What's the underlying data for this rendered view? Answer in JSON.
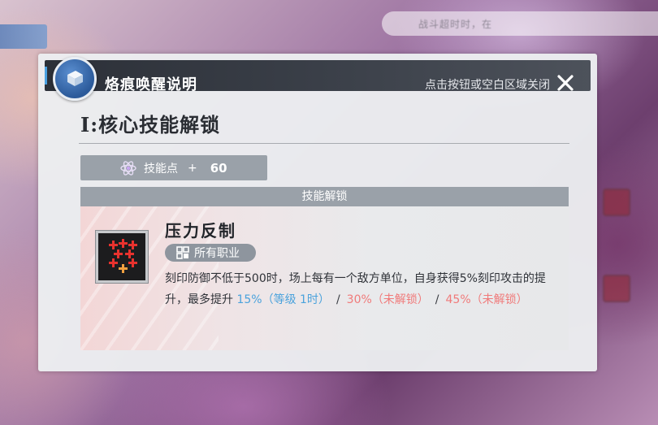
{
  "background": {
    "hint_text": "战斗超时时，在"
  },
  "dialog": {
    "title": "烙痕唤醒说明",
    "close_hint": "点击按钮或空白区域关闭",
    "section_title": "I:核心技能解锁",
    "skill_points": {
      "label": "技能点",
      "plus": "+",
      "value": "60"
    },
    "unlock_header": "技能解锁",
    "skill": {
      "name": "压力反制",
      "class_tag": "所有职业",
      "description": "刻印防御不低于500时，场上每有一个敌方单位，自身获得5%刻印攻击的提升，最多提升",
      "levels": [
        {
          "value": "15%",
          "status": "（等级 1时）",
          "color": "#4aa2dc"
        },
        {
          "value": "30%",
          "status": "（未解锁）",
          "color": "#f07a7a"
        },
        {
          "value": "45%",
          "status": "（未解锁）",
          "color": "#f07a7a"
        }
      ],
      "separator": "/"
    }
  },
  "icons": {
    "header_badge": "book-icon",
    "close": "close-icon",
    "skill_points": "atom-icon",
    "class_tag": "grid-icon",
    "skill": "skill-icon"
  }
}
